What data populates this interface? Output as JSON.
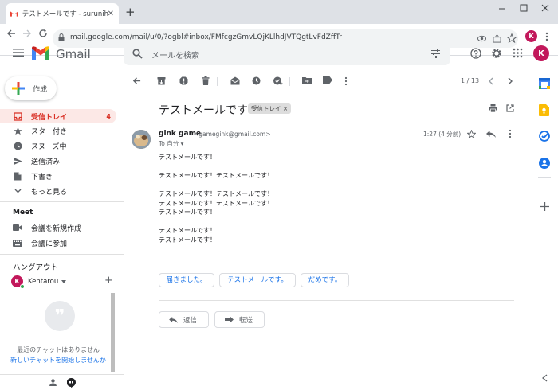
{
  "browser": {
    "tab_title": "テストメールです - surunihacom@gmail.com",
    "new_tab": "+",
    "url": "mail.google.com/mail/u/0/?ogbl#inbox/FMfcgzGmvLQjKLlhdJVTQgtLvFdZffTr",
    "profile_initial": "K"
  },
  "app": {
    "name": "Gmail",
    "search_placeholder": "メールを検索",
    "avatar_initial": "K"
  },
  "sidebar": {
    "compose": "作成",
    "items": [
      {
        "label": "受信トレイ",
        "count": "4"
      },
      {
        "label": "スター付き"
      },
      {
        "label": "スヌーズ中"
      },
      {
        "label": "送信済み"
      },
      {
        "label": "下書き"
      },
      {
        "label": "もっと見る"
      }
    ],
    "meet": {
      "title": "Meet",
      "new_meeting": "会議を新規作成",
      "join": "会議に参加"
    },
    "hangouts": {
      "title": "ハングアウト",
      "user": "Kentarou",
      "user_initial": "K",
      "add": "+",
      "no_chats": "最近のチャットはありません",
      "start_chat": "新しいチャットを開始しませんか"
    }
  },
  "toolbar": {
    "page": "1 / 13"
  },
  "message": {
    "subject": "テストメールです",
    "label": "受信トレイ ×",
    "sender_name": "gink game",
    "sender_email": "<gamegink@gmail.com>",
    "to": "To 自分 ▾",
    "time": "1:27 (4 分前)",
    "body": [
      "テストメールです！",
      "",
      "テストメールです！テストメールです！",
      "",
      "テストメールです！テストメールです！",
      "テストメールです！テストメールです！",
      "テストメールです！",
      "",
      "テストメールです！",
      "テストメールです！"
    ],
    "smart_replies": [
      "届きました。",
      "テストメールです。",
      "だめです。"
    ],
    "reply": "返信",
    "forward": "転送"
  },
  "colors": {
    "red": "#d93025",
    "blue": "#1a73e8",
    "active_bg": "#fce8e6"
  }
}
